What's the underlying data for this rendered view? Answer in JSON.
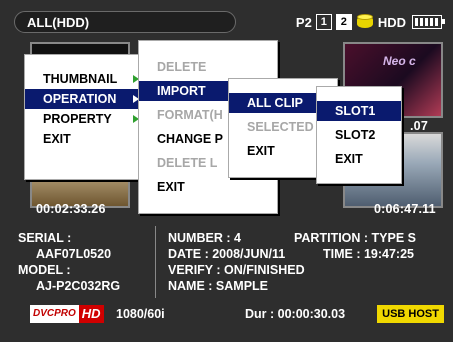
{
  "topbar": {
    "mode": "ALL(HDD)",
    "p2_label": "P2",
    "slot1": "1",
    "slot2": "2",
    "hdd_label": "HDD"
  },
  "thumbnails": {
    "timecodes": [
      "00:02:33.26",
      "0:06:47.11",
      ".07"
    ],
    "neon_text": "Neo c"
  },
  "menus": {
    "main": [
      {
        "label": "THUMBNAIL",
        "has_submenu": true
      },
      {
        "label": "OPERATION",
        "has_submenu": true,
        "selected": true
      },
      {
        "label": "PROPERTY",
        "has_submenu": true
      },
      {
        "label": "EXIT"
      }
    ],
    "operation": [
      {
        "label": "DELETE",
        "disabled": true
      },
      {
        "label": "IMPORT",
        "has_submenu": true,
        "selected": true
      },
      {
        "label": "FORMAT(H",
        "disabled": true
      },
      {
        "label": "CHANGE P"
      },
      {
        "label": "DELETE L",
        "disabled": true
      },
      {
        "label": "EXIT"
      }
    ],
    "import": [
      {
        "label": "ALL CLIP",
        "has_submenu": true,
        "selected": true
      },
      {
        "label": "SELECTED",
        "disabled": true
      },
      {
        "label": "EXIT"
      }
    ],
    "allclip": [
      {
        "label": "SLOT1",
        "selected": true
      },
      {
        "label": "SLOT2"
      },
      {
        "label": "EXIT"
      }
    ]
  },
  "info": {
    "serial_label": "SERIAL :",
    "serial_value": "AAF07L0520",
    "model_label": "MODEL :",
    "model_value": "AJ-P2C032RG",
    "number": "NUMBER : 4",
    "partition": "PARTITION : TYPE S",
    "date": "DATE : 2008/JUN/11",
    "time": "TIME : 19:47:25",
    "verify": "VERIFY : ON/FINISHED",
    "name": "NAME : SAMPLE"
  },
  "bottom": {
    "dvcpro_a": "DVCPRO",
    "dvcpro_b": "HD",
    "format": "1080/60i",
    "duration": "Dur : 00:00:30.03",
    "usb": "USB HOST"
  },
  "colors": {
    "selected_bg": "#0a1a6e",
    "arrow": "#2fa02f",
    "usb_host": "#f0d800",
    "dvcpro_red": "#d00000"
  }
}
